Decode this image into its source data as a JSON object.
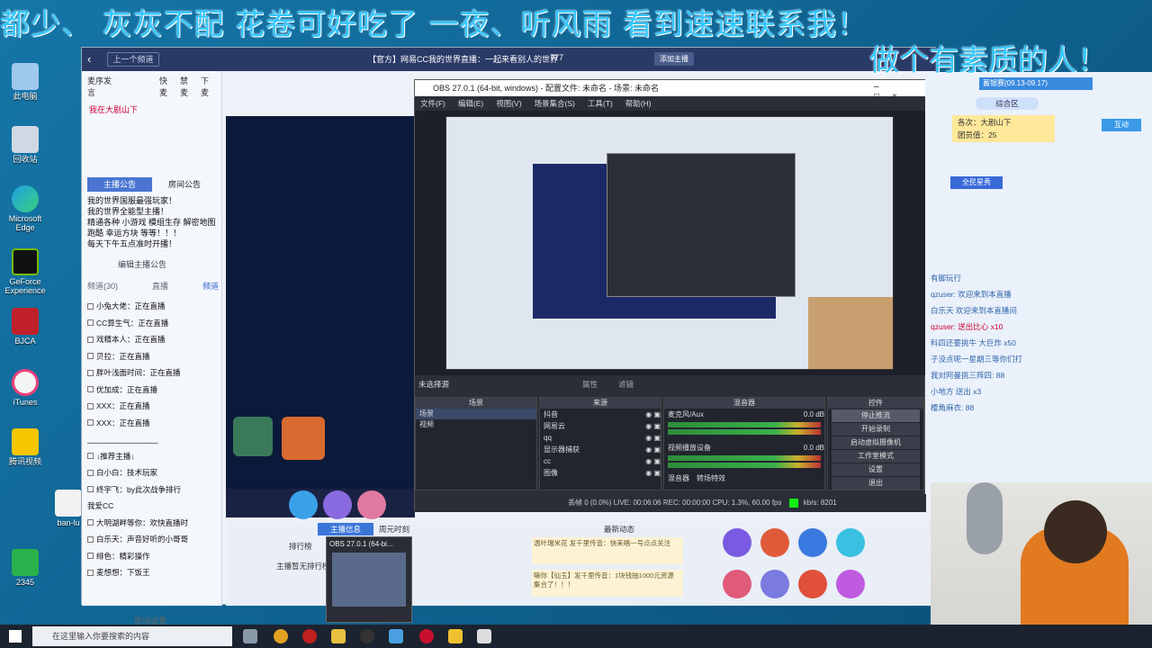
{
  "overlay": {
    "line1": "都少、 灰灰不配  花卷可好吃了  一夜、听风雨 看到速速联系我！",
    "line2": "做个有素质的人！"
  },
  "desktop_icons": [
    {
      "label": "此电脑"
    },
    {
      "label": "回收站"
    },
    {
      "label": "Microsoft Edge"
    },
    {
      "label": "GeForce Experience"
    },
    {
      "label": "BJCA"
    },
    {
      "label": "iTunes"
    },
    {
      "label": "腾讯视频"
    },
    {
      "label": "ban-lu"
    },
    {
      "label": "2345"
    }
  ],
  "cc": {
    "prev_label": "上一个频道",
    "title": "【官方】网易CC我的世界直播：一起来看别人的世界",
    "count": "777",
    "follow_label": "添加主播",
    "left_tabs": [
      "麦序发言",
      "快麦",
      "禁麦",
      "下麦"
    ],
    "mic_user": "我在大剧山下",
    "notice_tabs": [
      "主播公告",
      "房间公告"
    ],
    "notice": [
      "我的世界国服最强玩家！",
      "我的世界全能型主播！",
      "精通各种 小游戏 模组生存 解密地图",
      "跑酷 幸运方块 等等！！！",
      "每天下午五点准时开播！"
    ],
    "edit_notice": "编辑主播公告",
    "list_tabs": [
      "频道(30)",
      "直播",
      "频道"
    ],
    "list": [
      "小兔大佬：正在直播",
      "CC算生气：正在直播",
      "戏精本人：正在直播",
      "贝拉：正在直播",
      "胖叶浅面时间：正在直播",
      "优加成：正在直播",
      "XXX：正在直播",
      "XXX：正在直播"
    ],
    "list2": [
      "↓推荐主播↓",
      "白小白：技术玩家",
      "终宇飞：by此次战争排行",
      "我爱CC",
      "大明湖畔等你：欢快直播时",
      "白乐天：声音好听的小哥哥",
      "绯色：精彩操作",
      "麦想想：下饭王"
    ],
    "bottom_tabs": [
      "主播信息",
      "周元时刻",
      "最新动态"
    ],
    "rank_label": "排行榜",
    "no_rank": "主播暂无排行榜",
    "room_settings": "房间设置",
    "dynamic": [
      "温叶瑞米花 发千里传音：快来唱一号点点关注",
      "嘛你【仙玉】发千里传音：1块钱抽1000元资源 集合了！！！"
    ]
  },
  "obs": {
    "title": "OBS 27.0.1 (64-bit, windows) - 配置文件: 未命名 - 场景: 未命名",
    "menu": [
      "文件(F)",
      "编辑(E)",
      "视图(V)",
      "场景集合(S)",
      "工具(T)",
      "帮助(H)"
    ],
    "no_source": "未选择源",
    "props": "属性",
    "filters": "滤镜",
    "docks": {
      "scenes": "场景",
      "sources": "来源",
      "mixer": "混音器",
      "controls": "控件"
    },
    "scenes": [
      "场景",
      "视频"
    ],
    "sources": [
      "抖音",
      "网易云",
      "qq",
      "显示器捕获",
      "cc",
      "图像"
    ],
    "mixer": [
      {
        "name": "麦克风/Aux",
        "db": "0.0 dB"
      },
      {
        "name": "视频播放设备",
        "db": "0.0 dB"
      }
    ],
    "mixer_tabs": [
      "混音器",
      "转场特效"
    ],
    "controls": [
      "停止推流",
      "开始录制",
      "启动虚拟摄像机",
      "工作室模式",
      "设置",
      "退出"
    ],
    "status": "丢帧 0 (0.0%)   LIVE: 00:06:06   REC: 00:00:00   CPU: 1.3%, 60.00 fps",
    "kbps": "kb/s: 8201"
  },
  "taskbar_preview": "OBS 27.0.1 (64-bi...",
  "chat": {
    "header": "各次：大剧山下",
    "level": "团员值：25",
    "rank_tab": "全民星秀",
    "lines": [
      "有脚玩行",
      "qzuser: 欢迎来到本直播",
      "白乐天 欢迎来到本直播间",
      "qzuser: 送出比心 x10",
      "科四还要挑牛 大巨炸 x50",
      "子没点呢一星期三等你们打",
      "我对阿曼挑三阵四: 88",
      "小地方 送出 x3",
      "樱角麻衣: 88"
    ],
    "activity": "蓄银赛(09.13-09.17)",
    "rank_btn": "综合区",
    "interact": "互动"
  },
  "taskbar": {
    "search": "在这里输入你要搜索的内容"
  }
}
